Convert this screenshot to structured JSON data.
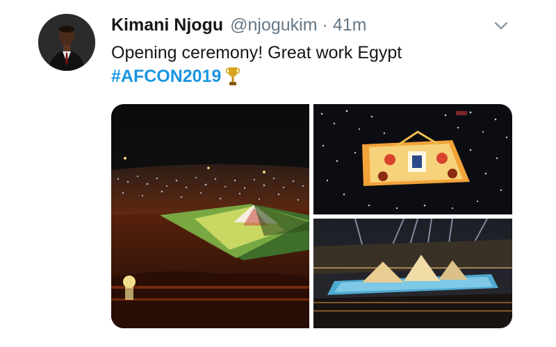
{
  "tweet": {
    "author_name": "Kimani Njogu",
    "handle": "@njogukim",
    "separator": "·",
    "timestamp": "41m",
    "text": "Opening ceremony! Great work Egypt",
    "hashtag": "#AFCON2019"
  },
  "icons": {
    "avatar": "profile-photo",
    "menu": "chevron-down-icon",
    "emoji": "trophy-icon"
  },
  "colors": {
    "link": "#1b95e0",
    "text": "#14171a",
    "muted": "#657786"
  }
}
